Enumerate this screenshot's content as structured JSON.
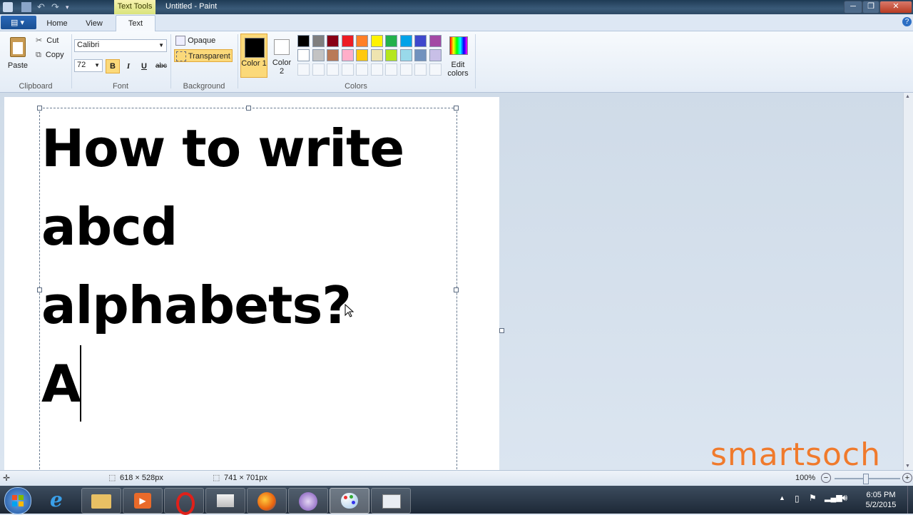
{
  "window": {
    "contextual_tab": "Text Tools",
    "title": "Untitled - Paint",
    "min_label": "─",
    "max_label": "❐",
    "close_label": "✕"
  },
  "tabs": {
    "home": "Home",
    "view": "View",
    "text": "Text"
  },
  "clipboard": {
    "paste": "Paste",
    "cut": "Cut",
    "copy": "Copy",
    "label": "Clipboard"
  },
  "font": {
    "family": "Calibri",
    "size": "72",
    "bold": "B",
    "italic": "I",
    "underline": "U",
    "strike": "abc",
    "label": "Font"
  },
  "background": {
    "opaque": "Opaque",
    "transparent": "Transparent",
    "label": "Background"
  },
  "colors": {
    "color1": "Color 1",
    "color2": "Color 2",
    "edit": "Edit colors",
    "label": "Colors",
    "color1_value": "#000000",
    "color2_value": "#ffffff",
    "palette_row1": [
      "#000000",
      "#7f7f7f",
      "#880015",
      "#ed1c24",
      "#ff7f27",
      "#fff200",
      "#22b14c",
      "#00a2e8",
      "#3f48cc",
      "#a349a4"
    ],
    "palette_row2": [
      "#ffffff",
      "#c3c3c3",
      "#b97a57",
      "#ffaec9",
      "#ffc90e",
      "#efe4b0",
      "#b5e61d",
      "#99d9ea",
      "#7092be",
      "#c8bfe7"
    ]
  },
  "canvas": {
    "lines": [
      "How to write",
      "abcd",
      "alphabets?",
      "A"
    ]
  },
  "status": {
    "selection": "618 × 528px",
    "size": "741 × 701px",
    "zoom": "100%"
  },
  "watermark": "smartsoch",
  "taskbar": {
    "time": "6:05 PM",
    "date": "5/2/2015"
  }
}
